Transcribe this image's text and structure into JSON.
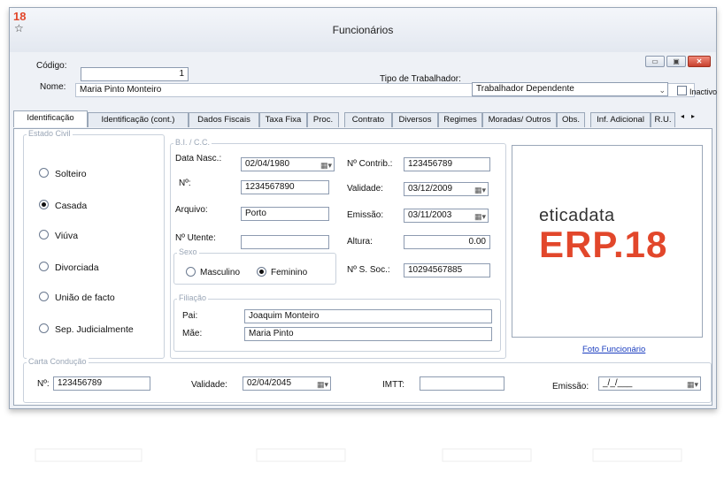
{
  "window": {
    "app_badge": "18",
    "title": "Funcionários",
    "min_symbol": "▭",
    "max_symbol": "▣",
    "close_symbol": "✕"
  },
  "header": {
    "codigo_label": "Código:",
    "codigo_value": "1",
    "nome_label": "Nome:",
    "nome_value": "Maria Pinto Monteiro",
    "tipo_label": "Tipo de Trabalhador:",
    "tipo_value": "Trabalhador Dependente",
    "inactivo_label": "Inactivo"
  },
  "tabs": [
    {
      "label": "Identificação"
    },
    {
      "label": "Identificação (cont.)"
    },
    {
      "label": "Dados Fiscais"
    },
    {
      "label": "Taxa Fixa"
    },
    {
      "label": "Proc."
    },
    {
      "label": "Contrato"
    },
    {
      "label": "Diversos"
    },
    {
      "label": "Regimes"
    },
    {
      "label": "Moradas/ Outros"
    },
    {
      "label": "Obs."
    },
    {
      "label": "Inf. Adicional"
    },
    {
      "label": "R.U."
    }
  ],
  "estado_civil": {
    "title": "Estado Civil",
    "options": [
      "Solteiro",
      "Casada",
      "Viúva",
      "Divorciada",
      "União de facto",
      "Sep. Judicialmente"
    ],
    "selected": "Casada"
  },
  "bi": {
    "title": "B.I. / C.C.",
    "data_nasc_label": "Data Nasc.:",
    "data_nasc_value": "02/04/1980",
    "n_label": "Nº:",
    "n_value": "1234567890",
    "arquivo_label": "Arquivo:",
    "arquivo_value": "Porto",
    "utente_label": "Nº Utente:",
    "utente_value": "",
    "contrib_label": "Nº Contrib.:",
    "contrib_value": "123456789",
    "validade_label": "Validade:",
    "validade_value": "03/12/2009",
    "emissao_label": "Emissão:",
    "emissao_value": "03/11/2003",
    "altura_label": "Altura:",
    "altura_value": "0.00",
    "ss_label": "Nº S. Soc.:",
    "ss_value": "10294567885"
  },
  "sexo": {
    "title": "Sexo",
    "masculino": "Masculino",
    "feminino": "Feminino",
    "selected": "Feminino"
  },
  "filiacao": {
    "title": "Filiação",
    "pai_label": "Pai:",
    "pai_value": "Joaquim Monteiro",
    "mae_label": "Mãe:",
    "mae_value": "Maria Pinto"
  },
  "photo": {
    "brand_top": "eticadata",
    "brand_bottom": "ERP.18",
    "link_label": "Foto Funcionário"
  },
  "carta": {
    "title": "Carta Condução",
    "n_label": "Nº:",
    "n_value": "123456789",
    "validade_label": "Validade:",
    "validade_value": "02/04/2045",
    "imtt_label": "IMTT:",
    "imtt_value": "",
    "emissao_label": "Emissão:",
    "emissao_value": "_/_/___"
  },
  "icons": {
    "calendar": "▦▾",
    "dropdown": "⌄",
    "star": "☆",
    "scroll_left": "◂",
    "scroll_right": "▸"
  },
  "colors": {
    "brand_red": "#e2472b",
    "link_blue": "#1a3dbf"
  }
}
